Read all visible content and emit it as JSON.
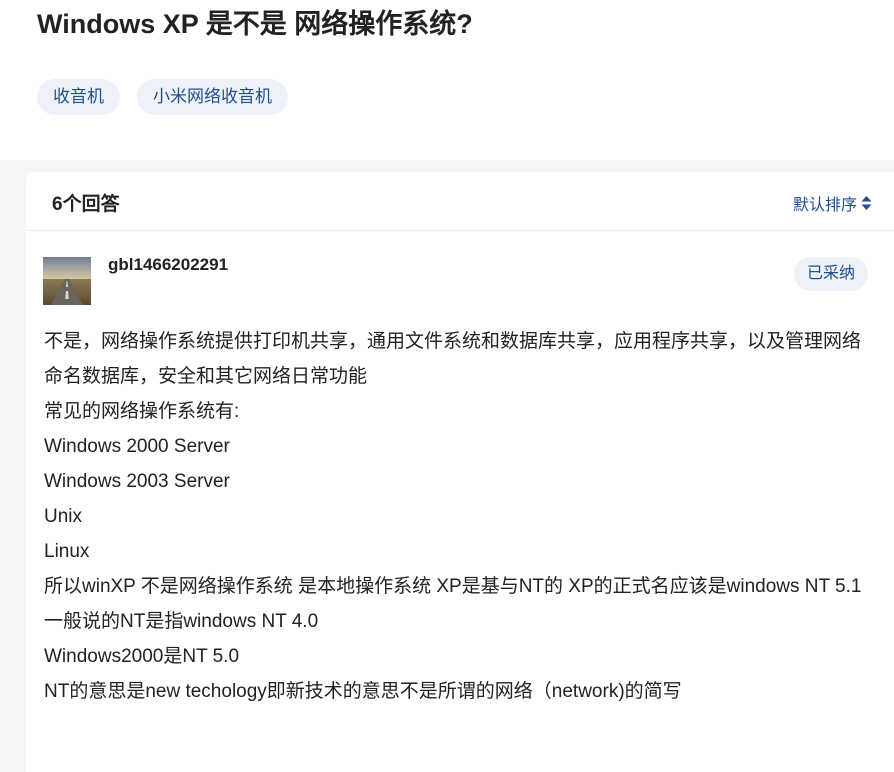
{
  "question": {
    "title": "Windows XP 是不是 网络操作系统?",
    "tags": [
      "收音机",
      "小米网络收音机"
    ]
  },
  "answers_header": {
    "count_label": "6个回答",
    "sort_label": "默认排序"
  },
  "answer": {
    "username": "gbl1466202291",
    "adopted_label": "已采纳",
    "avatar": "landscape-road-avatar",
    "paragraphs": [
      "不是，网络操作系统提供打印机共享，通用文件系统和数据库共享，应用程序共享，以及管理网络命名数据库，安全和其它网络日常功能",
      "常见的网络操作系统有:",
      "Windows 2000 Server",
      "Windows 2003 Server",
      "Unix",
      "Linux",
      "所以winXP 不是网络操作系统 是本地操作系统 XP是基与NT的 XP的正式名应该是windows NT 5.1",
      "一般说的NT是指windows NT 4.0",
      "Windows2000是NT 5.0",
      "NT的意思是new techology即新技术的意思不是所谓的网络（network)的简写"
    ]
  },
  "colors": {
    "accent": "#1f4f8f",
    "tag_bg": "#eef2f8",
    "page_bg": "#f5f6f7"
  }
}
